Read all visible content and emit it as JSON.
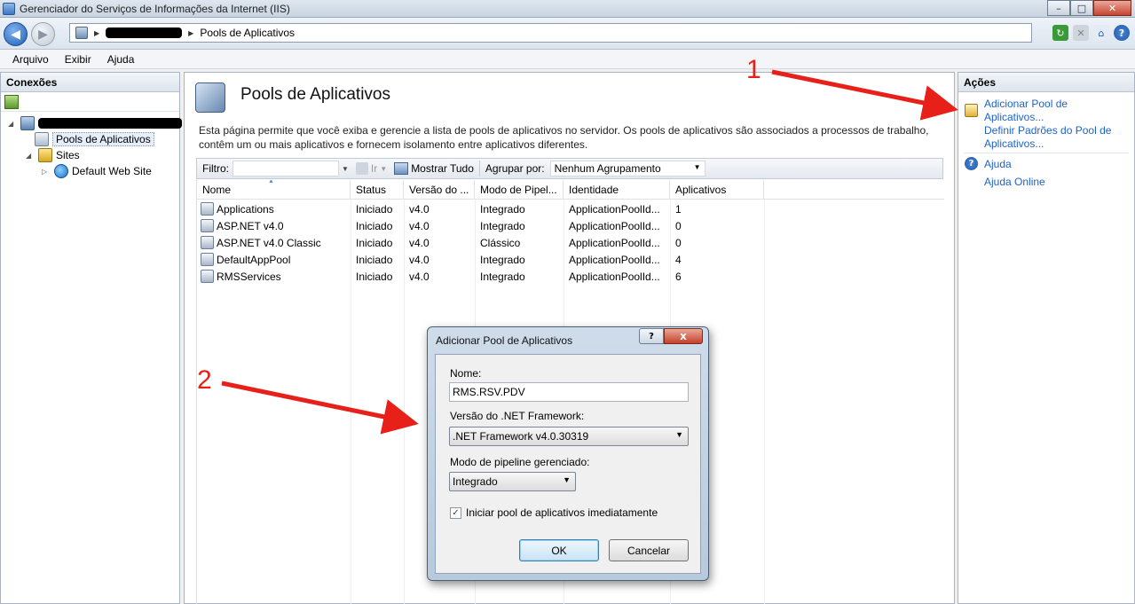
{
  "window": {
    "title": "Gerenciador do Serviços de Informações da Internet (IIS)"
  },
  "address": {
    "crumb": "Pools de Aplicativos"
  },
  "menu": [
    "Arquivo",
    "Exibir",
    "Ajuda"
  ],
  "connections": {
    "header": "Conexões",
    "nodes": {
      "pools": "Pools de Aplicativos",
      "sites": "Sites",
      "default_site": "Default Web Site"
    }
  },
  "main": {
    "title": "Pools de Aplicativos",
    "description": "Esta página permite que você exiba e gerencie a lista de pools de aplicativos no servidor. Os pools de aplicativos são associados a processos de trabalho, contêm um ou mais aplicativos e fornecem isolamento entre aplicativos diferentes.",
    "filter": {
      "label": "Filtro:",
      "go": "Ir",
      "show_all": "Mostrar Tudo",
      "group_label": "Agrupar por:",
      "group_value": "Nenhum Agrupamento"
    },
    "columns": [
      "Nome",
      "Status",
      "Versão do ...",
      "Modo de Pipel...",
      "Identidade",
      "Aplicativos"
    ],
    "rows": [
      {
        "name": "Applications",
        "status": "Iniciado",
        "version": "v4.0",
        "mode": "Integrado",
        "identity": "ApplicationPoolId...",
        "apps": "1"
      },
      {
        "name": "ASP.NET v4.0",
        "status": "Iniciado",
        "version": "v4.0",
        "mode": "Integrado",
        "identity": "ApplicationPoolId...",
        "apps": "0"
      },
      {
        "name": "ASP.NET v4.0 Classic",
        "status": "Iniciado",
        "version": "v4.0",
        "mode": "Clássico",
        "identity": "ApplicationPoolId...",
        "apps": "0"
      },
      {
        "name": "DefaultAppPool",
        "status": "Iniciado",
        "version": "v4.0",
        "mode": "Integrado",
        "identity": "ApplicationPoolId...",
        "apps": "4"
      },
      {
        "name": "RMSServices",
        "status": "Iniciado",
        "version": "v4.0",
        "mode": "Integrado",
        "identity": "ApplicationPoolId...",
        "apps": "6"
      }
    ]
  },
  "actions": {
    "header": "Ações",
    "add_pool_1": "Adicionar Pool de",
    "add_pool_2": "Aplicativos...",
    "defaults_1": "Definir Padrões do Pool de",
    "defaults_2": "Aplicativos...",
    "help": "Ajuda",
    "help_online": "Ajuda Online"
  },
  "dialog": {
    "title": "Adicionar Pool de Aplicativos",
    "help_btn": "?",
    "close_btn": "x",
    "name_label": "Nome:",
    "name_value": "RMS.RSV.PDV",
    "framework_label": "Versão do .NET Framework:",
    "framework_value": ".NET Framework v4.0.30319",
    "pipeline_label": "Modo de pipeline gerenciado:",
    "pipeline_value": "Integrado",
    "start_label": "Iniciar pool de aplicativos imediatamente",
    "start_checked": true,
    "ok": "OK",
    "cancel": "Cancelar"
  },
  "annotations": {
    "one": "1",
    "two": "2",
    "color": "#e8201a"
  }
}
